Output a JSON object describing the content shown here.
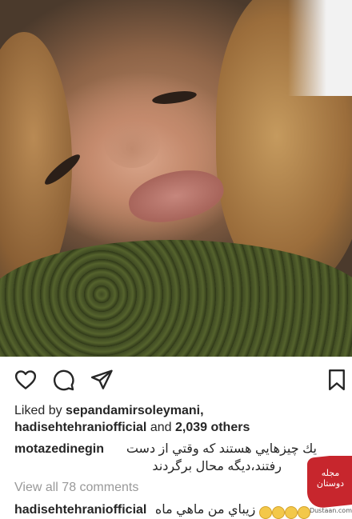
{
  "post": {
    "photo_alt": "selfie photo",
    "actions": {
      "like_icon": "heart-icon",
      "comment_icon": "comment-icon",
      "share_icon": "send-icon",
      "save_icon": "bookmark-icon"
    },
    "liked_by_prefix": "Liked by ",
    "liked_by_user": "sepandamirsoleymani,",
    "liked_by_user2": "hadisehtehraniofficial",
    "liked_by_and": " and ",
    "liked_by_count": "2,039 others",
    "comment1": {
      "username": "motazedinegin",
      "text_line1": "يك چيزهايي هستند كه وقتي از دست",
      "text_line2": "رفتند،ديگه محال برگردند"
    },
    "view_all": "View all 78 comments",
    "comment2": {
      "username": "hadisehtehraniofficial",
      "text": "زيباي من ماهي ماه"
    }
  },
  "watermark": {
    "label": "مجله دوستان",
    "site": "Dustaan.com"
  },
  "colors": {
    "text": "#262626",
    "muted": "#999999",
    "watermark_red": "#c7262d"
  }
}
